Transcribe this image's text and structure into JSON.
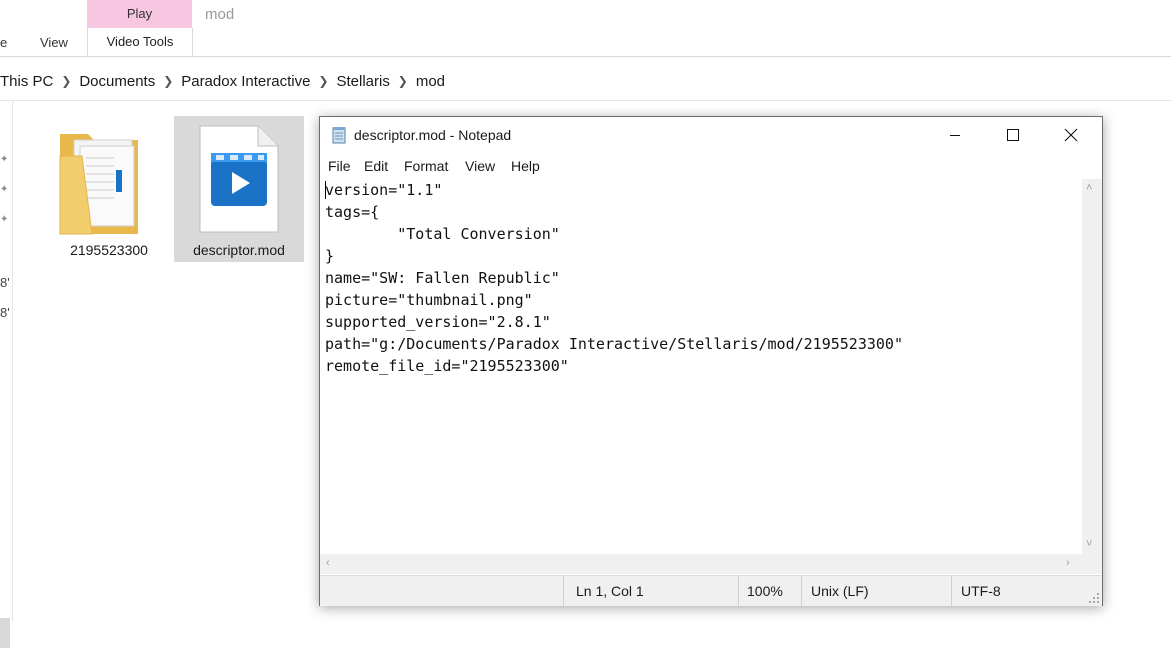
{
  "ribbon": {
    "tab_file_fragment": "e",
    "tab_view": "View",
    "contextual_group": "Play",
    "contextual_tab": "Video Tools",
    "folder_title": "mod"
  },
  "breadcrumb": [
    "This PC",
    "Documents",
    "Paradox Interactive",
    "Stellaris",
    "mod"
  ],
  "nav_fragments": [
    "8'",
    "8'"
  ],
  "files": [
    {
      "name": "2195523300",
      "icon": "folder-icon"
    },
    {
      "name": "descriptor.mod",
      "icon": "video-file-icon"
    }
  ],
  "notepad": {
    "title": "descriptor.mod - Notepad",
    "menus": [
      "File",
      "Edit",
      "Format",
      "View",
      "Help"
    ],
    "content": "version=\"1.1\"\ntags={\n\t\"Total Conversion\"\n}\nname=\"SW: Fallen Republic\"\npicture=\"thumbnail.png\"\nsupported_version=\"2.8.1\"\npath=\"g:/Documents/Paradox Interactive/Stellaris/mod/2195523300\"\nremote_file_id=\"2195523300\"",
    "status": {
      "position": "Ln 1, Col 1",
      "zoom": "100%",
      "line_endings": "Unix (LF)",
      "encoding": "UTF-8"
    }
  },
  "colors": {
    "contextual_tab": "#f7c6e0",
    "selection": "#d9d9d9",
    "media_icon_blue": "#1a73c6"
  }
}
